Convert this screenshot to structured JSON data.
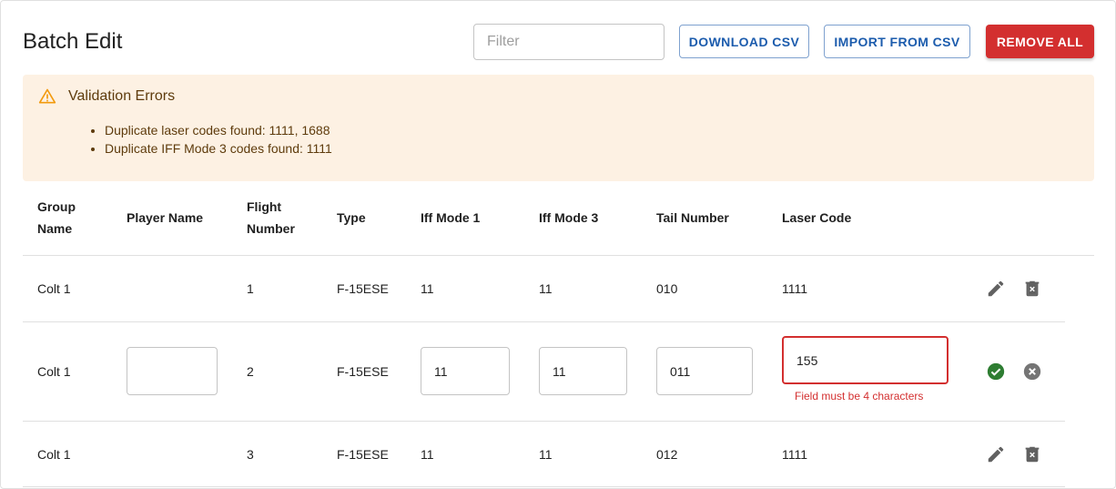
{
  "header": {
    "title": "Batch Edit",
    "filter_placeholder": "Filter",
    "download_label": "DOWNLOAD CSV",
    "import_label": "IMPORT FROM CSV",
    "remove_all_label": "REMOVE ALL"
  },
  "alert": {
    "title": "Validation Errors",
    "messages": [
      "Duplicate laser codes found: 1111, 1688",
      "Duplicate IFF Mode 3 codes found: 1111"
    ]
  },
  "table": {
    "headers": {
      "group_name": "Group Name",
      "player_name": "Player Name",
      "flight_number": "Flight Number",
      "type": "Type",
      "iff_mode_1": "Iff Mode 1",
      "iff_mode_3": "Iff Mode 3",
      "tail_number": "Tail Number",
      "laser_code": "Laser Code"
    },
    "rows": [
      {
        "group": "Colt 1",
        "player": "",
        "flight": "1",
        "type": "F-15ESE",
        "iff1": "11",
        "iff3": "11",
        "tail": "010",
        "laser": "1111"
      },
      {
        "group": "Colt 1",
        "player": "",
        "flight": "2",
        "type": "F-15ESE",
        "iff1": "11",
        "iff3": "11",
        "tail": "011",
        "laser": "155",
        "laser_error": "Field must be 4 characters"
      },
      {
        "group": "Colt 1",
        "player": "",
        "flight": "3",
        "type": "F-15ESE",
        "iff1": "11",
        "iff3": "11",
        "tail": "012",
        "laser": "1111"
      }
    ]
  },
  "colors": {
    "primary": "#1c5cad",
    "danger": "#d32f2f",
    "warning_bg": "#fdf1e3",
    "success": "#2e7d32"
  }
}
